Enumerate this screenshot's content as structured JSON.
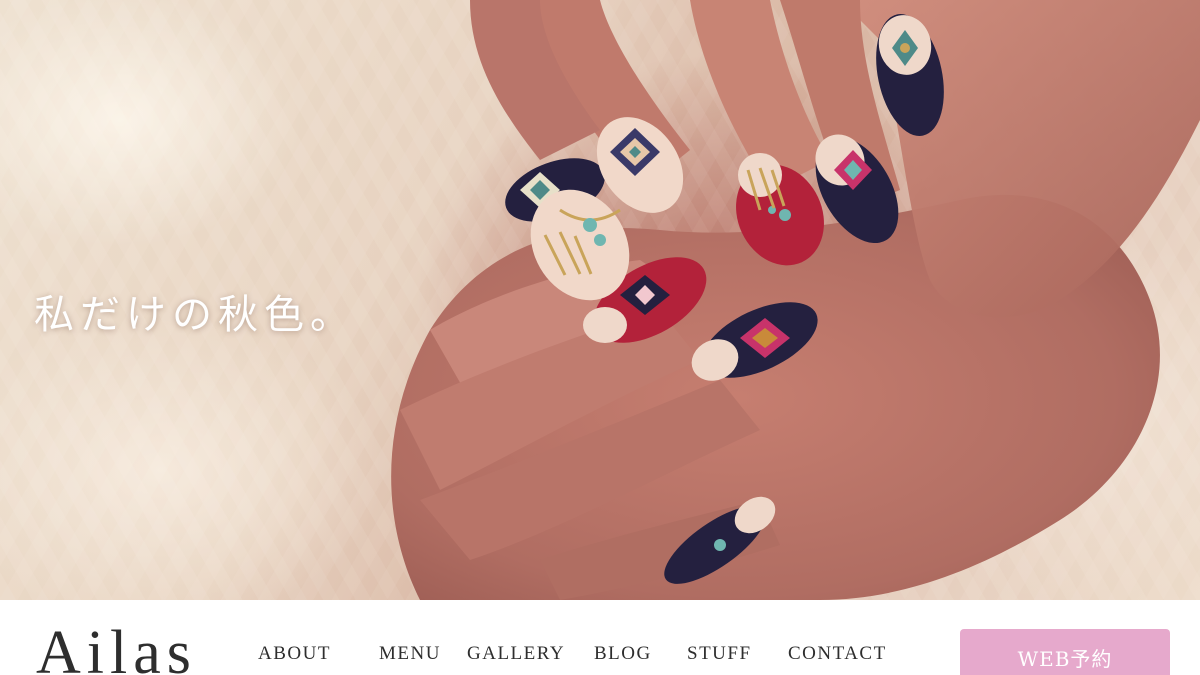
{
  "hero": {
    "tagline": "私だけの秋色。"
  },
  "header": {
    "logo": "Ailas",
    "nav": [
      {
        "label": "ABOUT"
      },
      {
        "label": "MENU"
      },
      {
        "label": "GALLERY"
      },
      {
        "label": "BLOG"
      },
      {
        "label": "STUFF"
      },
      {
        "label": "CONTACT"
      }
    ],
    "cta_label": "WEB予約"
  },
  "colors": {
    "cta_background": "#e6a9cc",
    "text": "#2e2e2e",
    "nail_navy": "#24203f",
    "nail_red": "#b3223a",
    "nail_nude": "#f1d8c9",
    "accent_gold": "#c9a45a"
  }
}
